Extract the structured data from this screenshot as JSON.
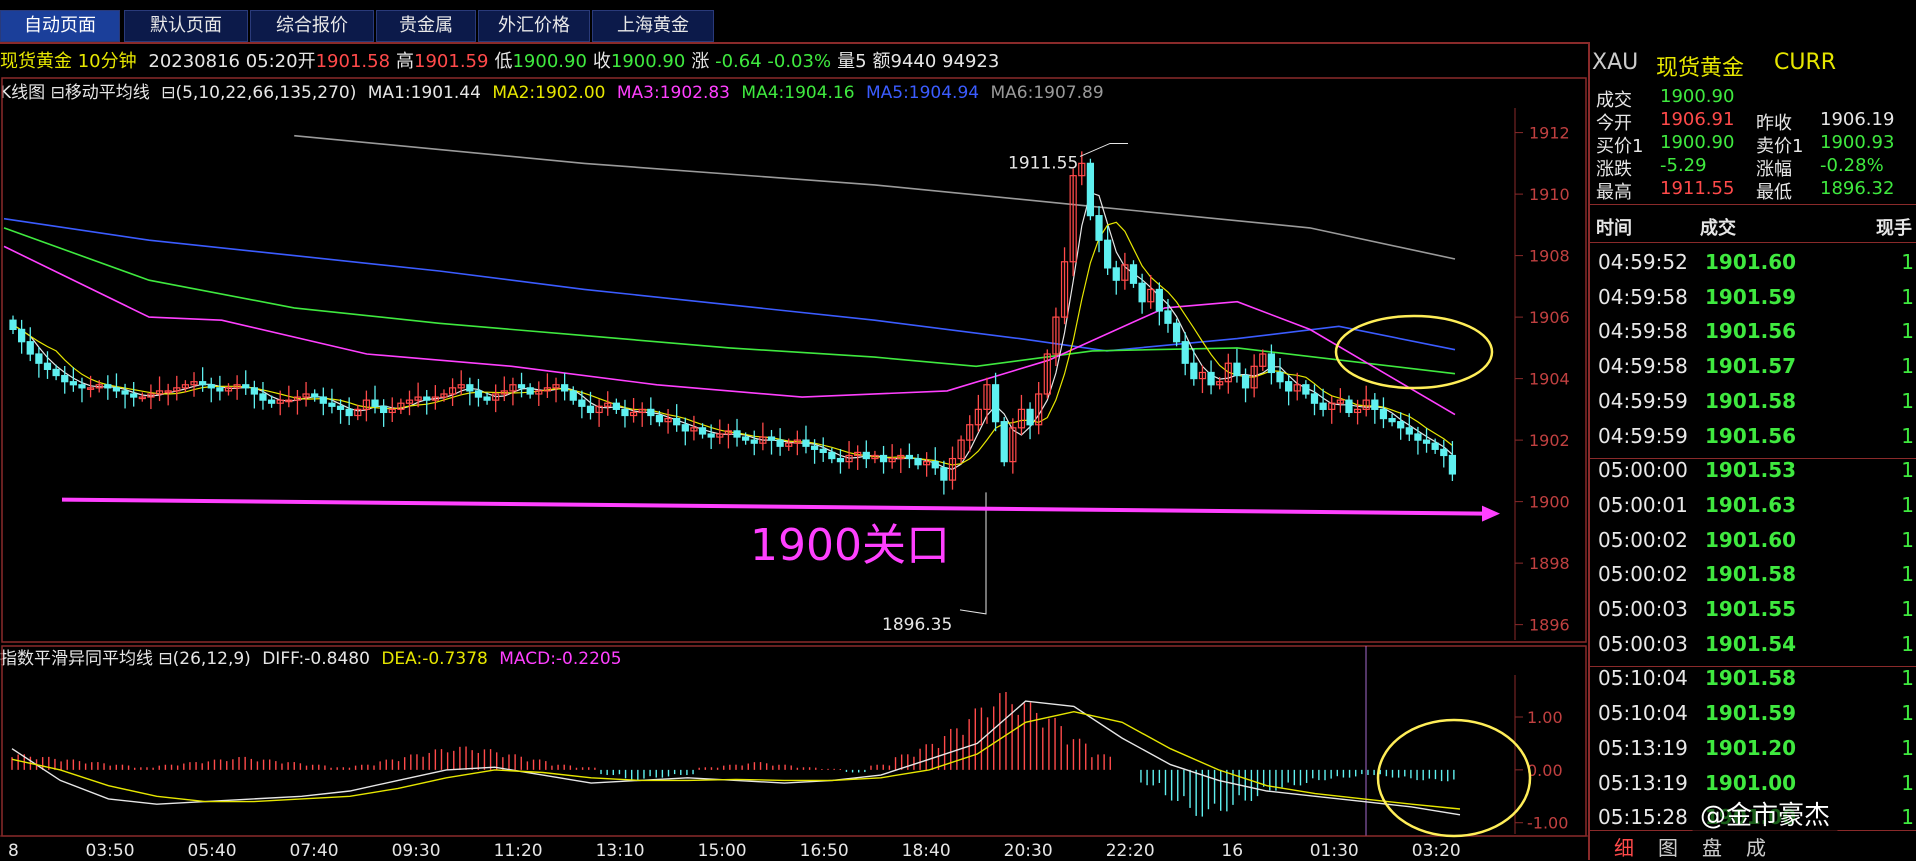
{
  "tabs": [
    "自动页面",
    "默认页面",
    "综合报价",
    "贵金属",
    "外汇价格",
    "上海黄金"
  ],
  "info": {
    "name": "现货黄金 10分钟",
    "datetime": "20230816 05:20",
    "open_label": "开",
    "open": "1901.58",
    "high_label": "高",
    "high": "1901.59",
    "low_label": "低",
    "low": "1900.90",
    "close_label": "收",
    "close": "1900.90",
    "chg_label": "涨",
    "chg": "-0.64",
    "chg_pct": "-0.03%",
    "vol_label": "量",
    "vol": "5",
    "amt_label": "额",
    "amt": "9440 94923"
  },
  "ma_bar": {
    "title": "K线图",
    "indicator": "移动平均线",
    "params": "(5,10,22,66,135,270)",
    "ma1": "MA1:1901.44",
    "ma2": "MA2:1902.00",
    "ma3": "MA3:1902.83",
    "ma4": "MA4:1904.16",
    "ma5": "MA5:1904.94",
    "ma6": "MA6:1907.89"
  },
  "macd_bar": {
    "indicator": "指数平滑异同平均线",
    "params": "(26,12,9)",
    "diff": "DIFF:-0.8480",
    "dea": "DEA:-0.7378",
    "macd": "MACD:-0.2205"
  },
  "colors": {
    "ma1": "#e6e6e6",
    "ma2": "#e6e600",
    "ma3": "#ff40ff",
    "ma4": "#3fe93f",
    "ma5": "#3b5cff",
    "ma6": "#9a9a9a",
    "up": "#ff4a4a",
    "down": "#5ff0f0",
    "annotation": "#ff40ff",
    "circle": "#ffee58"
  },
  "chart_data": {
    "type": "candlestick",
    "y_ticks": [
      "1912",
      "1910",
      "1908",
      "1906",
      "1904",
      "1902",
      "1900",
      "1898",
      "1896"
    ],
    "ylim": [
      1895.5,
      1912.8
    ],
    "x_ticks": [
      "8",
      "03:50",
      "05:40",
      "07:40",
      "09:30",
      "11:20",
      "13:10",
      "15:00",
      "16:50",
      "18:40",
      "20:30",
      "22:20",
      "16",
      "01:30",
      "03:20"
    ],
    "high_point": {
      "label": "1911.55",
      "value": 1911.55
    },
    "low_point": {
      "label": "1896.35",
      "value": 1896.35
    },
    "annotation": {
      "text": "1900关口",
      "level": 1900
    },
    "close_path": [
      1905.6,
      1905.2,
      1904.8,
      1904.5,
      1904.3,
      1904.1,
      1903.9,
      1903.8,
      1903.7,
      1903.7,
      1903.8,
      1903.7,
      1903.6,
      1903.5,
      1903.4,
      1903.4,
      1903.5,
      1903.6,
      1903.6,
      1903.7,
      1903.8,
      1903.9,
      1903.8,
      1903.7,
      1903.6,
      1903.7,
      1903.8,
      1903.7,
      1903.5,
      1903.3,
      1903.2,
      1903.3,
      1903.3,
      1903.4,
      1903.5,
      1903.4,
      1903.2,
      1903.1,
      1903.0,
      1902.8,
      1903.0,
      1903.3,
      1903.1,
      1902.9,
      1903.0,
      1903.2,
      1903.3,
      1903.4,
      1903.3,
      1903.4,
      1903.5,
      1903.7,
      1903.8,
      1903.6,
      1903.4,
      1903.3,
      1903.5,
      1903.6,
      1903.8,
      1903.7,
      1903.5,
      1903.6,
      1903.7,
      1903.8,
      1903.6,
      1903.3,
      1903.1,
      1902.9,
      1903.1,
      1903.2,
      1903.0,
      1902.8,
      1902.9,
      1903.0,
      1902.8,
      1902.6,
      1902.7,
      1902.5,
      1902.3,
      1902.4,
      1902.2,
      1902.1,
      1902.2,
      1902.3,
      1902.1,
      1902.0,
      1901.9,
      1902.1,
      1902.0,
      1901.8,
      1901.9,
      1902.0,
      1901.8,
      1901.7,
      1901.6,
      1901.4,
      1901.3,
      1901.5,
      1901.6,
      1901.4,
      1901.5,
      1901.3,
      1901.4,
      1901.5,
      1901.4,
      1901.2,
      1901.3,
      1901.1,
      1900.7,
      1901.4,
      1902.0,
      1902.5,
      1903.0,
      1903.8,
      1902.6,
      1901.3,
      1902.4,
      1903.0,
      1902.5,
      1903.5,
      1904.8,
      1906.0,
      1907.8,
      1910.6,
      1911.0,
      1909.3,
      1908.5,
      1907.6,
      1907.2,
      1907.7,
      1907.1,
      1906.5,
      1906.9,
      1906.2,
      1905.8,
      1905.2,
      1904.5,
      1904.0,
      1904.2,
      1903.8,
      1903.9,
      1904.5,
      1904.1,
      1903.7,
      1904.4,
      1904.8,
      1904.2,
      1903.9,
      1903.6,
      1903.8,
      1903.5,
      1903.2,
      1903.0,
      1903.2,
      1903.3,
      1902.9,
      1903.0,
      1903.3,
      1903.0,
      1902.7,
      1902.6,
      1902.4,
      1902.2,
      1902.0,
      1901.9,
      1901.7,
      1901.5,
      1900.9
    ],
    "ma_lines": [
      {
        "name": "MA5",
        "pts": [
          [
            0,
            1909.2
          ],
          [
            0.1,
            1908.5
          ],
          [
            0.2,
            1908.0
          ],
          [
            0.3,
            1907.5
          ],
          [
            0.4,
            1906.9
          ],
          [
            0.5,
            1906.4
          ],
          [
            0.6,
            1905.9
          ],
          [
            0.7,
            1905.3
          ],
          [
            0.76,
            1904.9
          ],
          [
            0.85,
            1905.3
          ],
          [
            0.92,
            1905.7
          ],
          [
            1,
            1904.94
          ]
        ]
      },
      {
        "name": "MA6",
        "pts": [
          [
            0.2,
            1911.9
          ],
          [
            0.4,
            1911.0
          ],
          [
            0.6,
            1910.3
          ],
          [
            0.75,
            1909.6
          ],
          [
            0.9,
            1908.9
          ],
          [
            1,
            1907.89
          ]
        ]
      },
      {
        "name": "MA4",
        "pts": [
          [
            0,
            1908.9
          ],
          [
            0.1,
            1907.2
          ],
          [
            0.2,
            1906.3
          ],
          [
            0.3,
            1905.8
          ],
          [
            0.4,
            1905.4
          ],
          [
            0.5,
            1905.0
          ],
          [
            0.6,
            1904.7
          ],
          [
            0.67,
            1904.4
          ],
          [
            0.75,
            1904.9
          ],
          [
            0.85,
            1905.0
          ],
          [
            1,
            1904.16
          ]
        ]
      },
      {
        "name": "MA3",
        "pts": [
          [
            0,
            1908.3
          ],
          [
            0.1,
            1906.0
          ],
          [
            0.15,
            1905.9
          ],
          [
            0.25,
            1904.8
          ],
          [
            0.35,
            1904.4
          ],
          [
            0.45,
            1903.8
          ],
          [
            0.55,
            1903.4
          ],
          [
            0.65,
            1903.6
          ],
          [
            0.72,
            1904.6
          ],
          [
            0.8,
            1906.3
          ],
          [
            0.85,
            1906.5
          ],
          [
            0.9,
            1905.6
          ],
          [
            1,
            1902.83
          ]
        ]
      }
    ],
    "macd": {
      "ylim": [
        -1.1,
        1.7
      ],
      "y_ticks": [
        "1.00",
        "0.00",
        "-1.00"
      ],
      "hist": [
        0.3,
        0.25,
        0.2,
        0.15,
        0.1,
        0.05,
        0.1,
        0.15,
        0.2,
        0.25,
        0.2,
        0.15,
        0.1,
        0.05,
        0.1,
        0.2,
        0.3,
        0.4,
        0.45,
        0.4,
        0.3,
        0.2,
        0.1,
        0.05,
        -0.1,
        -0.2,
        -0.15,
        -0.1,
        0.05,
        0.1,
        0.15,
        0.1,
        0.05,
        0.02,
        -0.05,
        0.1,
        0.3,
        0.5,
        0.8,
        1.2,
        1.5,
        1.3,
        1.0,
        0.6,
        0.3,
        0.0,
        -0.3,
        -0.6,
        -0.9,
        -0.8,
        -0.6,
        -0.4,
        -0.3,
        -0.2,
        -0.15,
        -0.1,
        -0.15,
        -0.2,
        -0.22
      ],
      "diff": [
        0.4,
        -0.2,
        -0.55,
        -0.65,
        -0.6,
        -0.55,
        -0.5,
        -0.4,
        -0.2,
        0.0,
        0.05,
        -0.1,
        -0.25,
        -0.2,
        -0.15,
        -0.2,
        -0.25,
        -0.2,
        -0.1,
        0.2,
        0.5,
        1.3,
        1.2,
        0.6,
        0.1,
        -0.2,
        -0.4,
        -0.5,
        -0.6,
        -0.7,
        -0.85
      ],
      "dea": [
        0.2,
        0.0,
        -0.3,
        -0.5,
        -0.6,
        -0.6,
        -0.55,
        -0.5,
        -0.35,
        -0.15,
        0.0,
        -0.05,
        -0.15,
        -0.2,
        -0.2,
        -0.18,
        -0.2,
        -0.2,
        -0.15,
        0.0,
        0.3,
        0.9,
        1.1,
        0.9,
        0.4,
        0.0,
        -0.3,
        -0.45,
        -0.55,
        -0.65,
        -0.74
      ]
    }
  },
  "panel": {
    "symbol": "XAU",
    "name": "现货黄金",
    "type": "CURR",
    "fields": [
      {
        "k": "成交",
        "v": "1900.90",
        "c": "g"
      },
      {
        "k": "今开",
        "v": "1906.91",
        "c": "r",
        "k2": "昨收",
        "v2": "1906.19",
        "c2": "w"
      },
      {
        "k": "买价1",
        "v": "1900.90",
        "c": "g",
        "k2": "卖价1",
        "v2": "1900.93",
        "c2": "g"
      },
      {
        "k": "涨跌",
        "v": "-5.29",
        "c": "g",
        "k2": "涨幅",
        "v2": "-0.28%",
        "c2": "g"
      },
      {
        "k": "最高",
        "v": "1911.55",
        "c": "r",
        "k2": "最低",
        "v2": "1896.32",
        "c2": "g"
      }
    ],
    "headers": {
      "time": "时间",
      "price": "成交",
      "qty": "现手"
    },
    "ticks": [
      {
        "t": "04:59:52",
        "p": "1901.60",
        "v": "1"
      },
      {
        "t": "04:59:58",
        "p": "1901.59",
        "v": "1"
      },
      {
        "t": "04:59:58",
        "p": "1901.56",
        "v": "1"
      },
      {
        "t": "04:59:58",
        "p": "1901.57",
        "v": "1"
      },
      {
        "t": "04:59:59",
        "p": "1901.58",
        "v": "1"
      },
      {
        "t": "04:59:59",
        "p": "1901.56",
        "v": "1"
      },
      {
        "t": "05:00:00",
        "p": "1901.53",
        "v": "1"
      },
      {
        "t": "05:00:01",
        "p": "1901.63",
        "v": "1"
      },
      {
        "t": "05:00:02",
        "p": "1901.60",
        "v": "1"
      },
      {
        "t": "05:00:02",
        "p": "1901.58",
        "v": "1"
      },
      {
        "t": "05:00:03",
        "p": "1901.55",
        "v": "1"
      },
      {
        "t": "05:00:03",
        "p": "1901.54",
        "v": "1"
      },
      {
        "t": "05:10:04",
        "p": "1901.58",
        "v": "1"
      },
      {
        "t": "05:10:04",
        "p": "1901.59",
        "v": "1"
      },
      {
        "t": "05:13:19",
        "p": "1901.20",
        "v": "1"
      },
      {
        "t": "05:13:19",
        "p": "1901.00",
        "v": "1"
      },
      {
        "t": "05:15:28",
        "p": "1901.00",
        "v": "1"
      }
    ],
    "bottom_tabs": [
      "细",
      "图",
      "盘",
      "成"
    ],
    "watermark": "@金市豪杰"
  }
}
